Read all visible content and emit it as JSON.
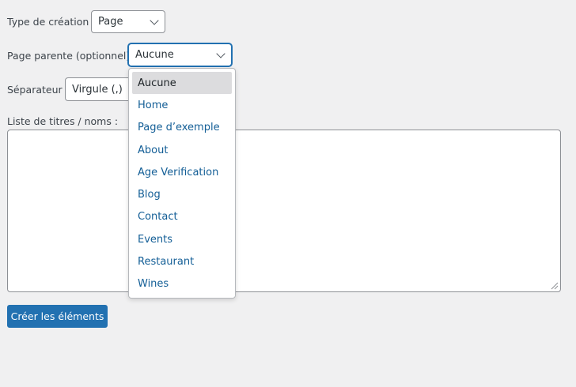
{
  "form": {
    "type_label": "Type de création :",
    "type_value": "Page",
    "parent_label": "Page parente (optionnel) :",
    "parent_value": "Aucune",
    "separator_label": "Séparateur :",
    "separator_value": "Virgule (,)",
    "titles_label": "Liste de titres / noms :",
    "titles_value": "",
    "submit_label": "Créer les éléments"
  },
  "dropdown": {
    "selected": "Aucune",
    "options": [
      {
        "label": "Aucune"
      },
      {
        "label": "Home"
      },
      {
        "label": "Page d’exemple"
      },
      {
        "label": "About"
      },
      {
        "label": "Age Verification"
      },
      {
        "label": "Blog"
      },
      {
        "label": "Contact"
      },
      {
        "label": "Events"
      },
      {
        "label": "Restaurant"
      },
      {
        "label": "Wines"
      }
    ]
  },
  "colors": {
    "accent": "#2271b1",
    "option_text": "#135e96",
    "hover_bg": "#dcdcde",
    "page_bg": "#f0f0f1"
  }
}
